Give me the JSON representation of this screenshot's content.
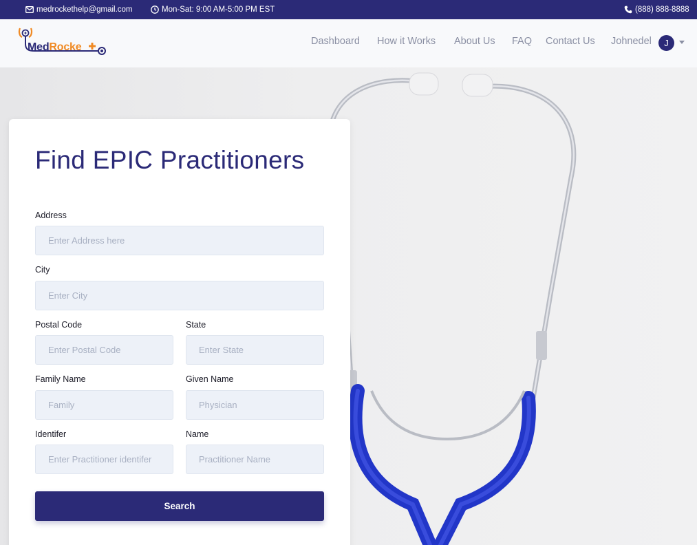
{
  "topbar": {
    "email": "medrockethelp@gmail.com",
    "hours": "Mon-Sat: 9:00 AM-5:00 PM EST",
    "phone": "(888) 888-8888",
    "icons": {
      "email": "envelope-icon",
      "hours": "clock-icon",
      "phone": "phone-icon"
    }
  },
  "brand": {
    "name_part1": "Med",
    "name_part2": "Rocke",
    "colors": {
      "primary": "#2b2a77",
      "accent": "#f08a24"
    }
  },
  "nav": {
    "items": [
      {
        "label": "Dashboard"
      },
      {
        "label": "How it Works"
      },
      {
        "label": "About Us"
      },
      {
        "label": "FAQ"
      },
      {
        "label": "Contact Us"
      }
    ],
    "user": {
      "name": "Johnedel",
      "initial": "J"
    }
  },
  "form": {
    "title": "Find EPIC Practitioners",
    "fields": {
      "address": {
        "label": "Address",
        "placeholder": "Enter Address here",
        "value": ""
      },
      "city": {
        "label": "City",
        "placeholder": "Enter City",
        "value": ""
      },
      "postal_code": {
        "label": "Postal Code",
        "placeholder": "Enter Postal Code",
        "value": ""
      },
      "state": {
        "label": "State",
        "placeholder": "Enter State",
        "value": ""
      },
      "family_name": {
        "label": "Family Name",
        "placeholder": "Family",
        "value": ""
      },
      "given_name": {
        "label": "Given Name",
        "placeholder": "Physician",
        "value": ""
      },
      "identifier": {
        "label": "Identifer",
        "placeholder": "Enter Practitioner identifer",
        "value": ""
      },
      "name": {
        "label": "Name",
        "placeholder": "Practitioner Name",
        "value": ""
      }
    },
    "submit_label": "Search"
  }
}
